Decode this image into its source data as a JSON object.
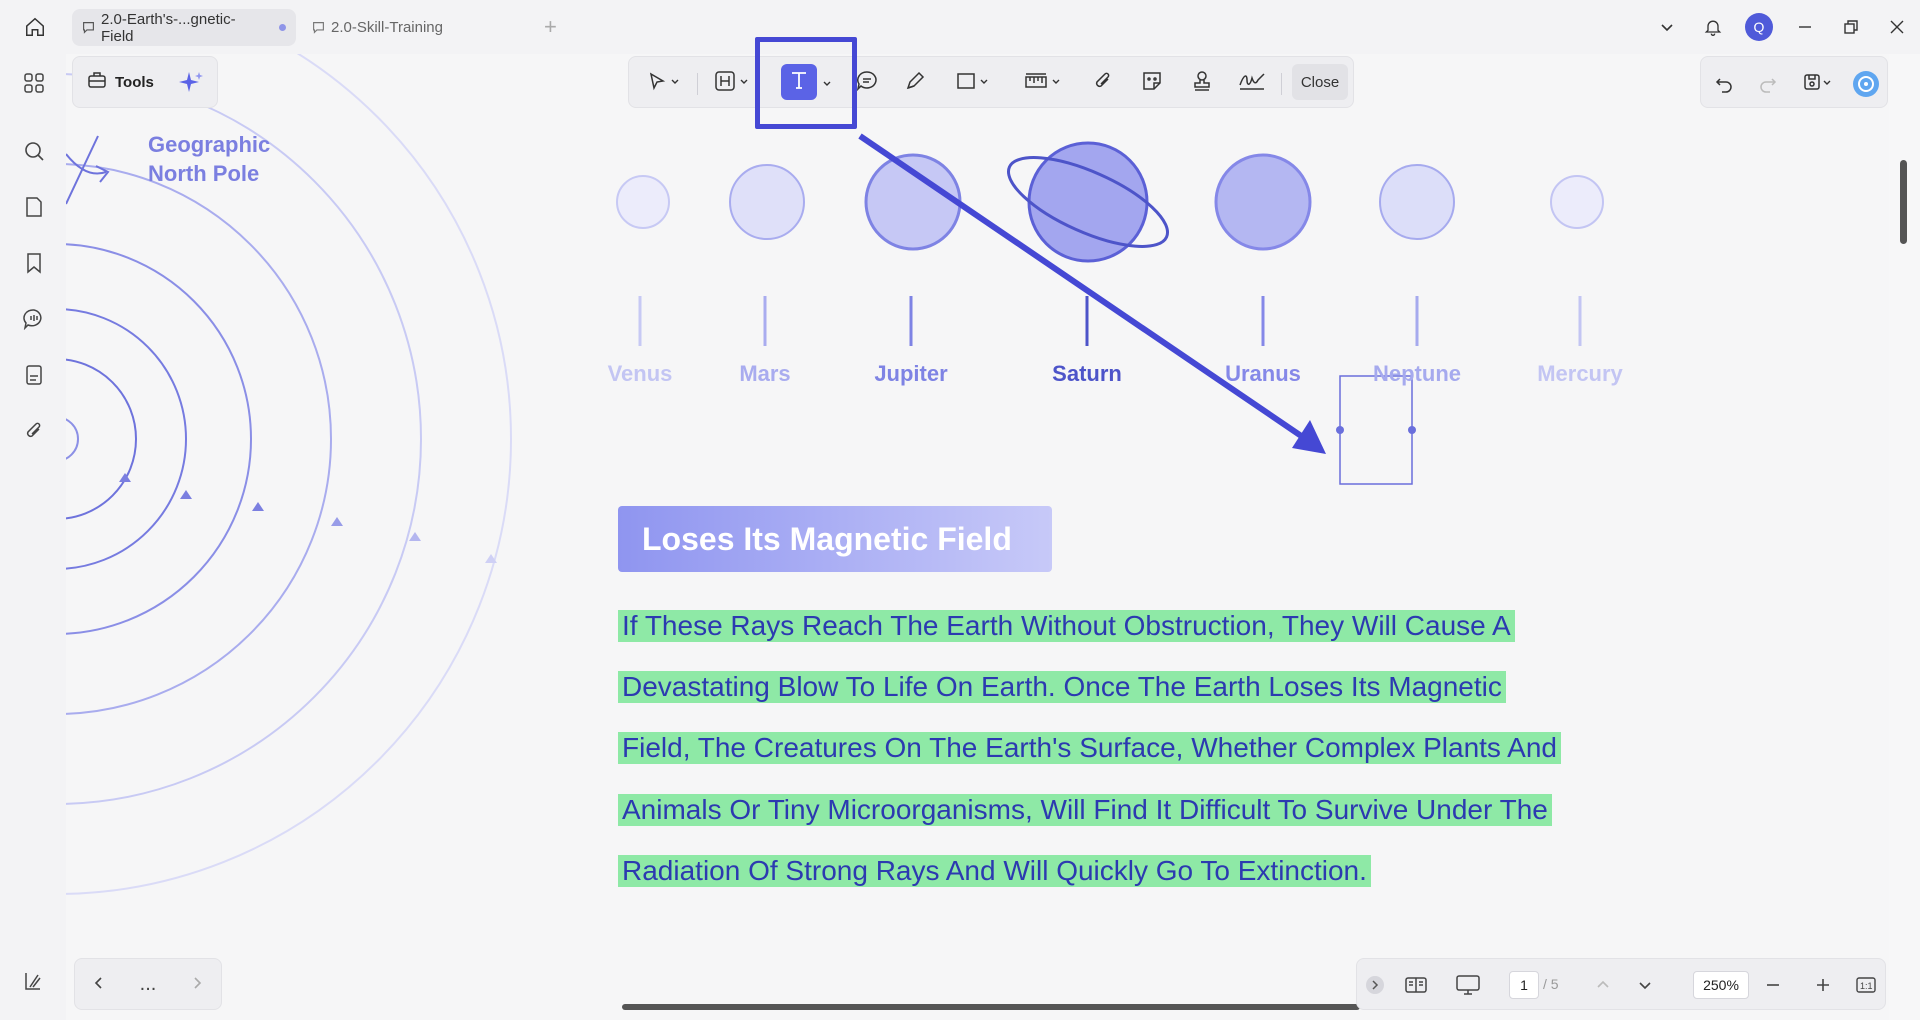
{
  "tabs": [
    {
      "label": "2.0-Earth's-...gnetic-Field",
      "active": true
    },
    {
      "label": "2.0-Skill-Training",
      "active": false
    }
  ],
  "user": {
    "avatar_letter": "Q"
  },
  "tools": {
    "label": "Tools"
  },
  "toolbar": {
    "close_label": "Close",
    "active_tool": "text-tool"
  },
  "document": {
    "geo_label_line1": "Geographic",
    "geo_label_line2": "North Pole",
    "planets": [
      {
        "name": "Venus",
        "color": "#c7c9f4"
      },
      {
        "name": "Mars",
        "color": "#a9acef"
      },
      {
        "name": "Jupiter",
        "color": "#7e83e4"
      },
      {
        "name": "Saturn",
        "color": "#4d54c9"
      },
      {
        "name": "Uranus",
        "color": "#8588e8"
      },
      {
        "name": "Neptune",
        "color": "#a6aaee"
      },
      {
        "name": "Mercury",
        "color": "#c3c5f3"
      }
    ],
    "section_title": "Loses Its Magnetic Field",
    "paragraph_lines": [
      "If These Rays Reach The Earth Without Obstruction, They Will Cause A",
      "Devastating Blow To Life On Earth. Once The Earth Loses Its Magnetic",
      "Field, The Creatures On The Earth's Surface, Whether Complex Plants And",
      "Animals Or Tiny Microorganisms, Will Find It Difficult To Survive Under The",
      "Radiation Of Strong Rays And Will Quickly Go To Extinction."
    ]
  },
  "bottom": {
    "more_label": "...",
    "page_current": "1",
    "page_total": "/ 5",
    "zoom": "250%"
  },
  "colors": {
    "accent": "#5b63e6",
    "annotation": "#4548d4",
    "highlight": "#8ee9a6",
    "text_blue": "#2c3ab0"
  }
}
